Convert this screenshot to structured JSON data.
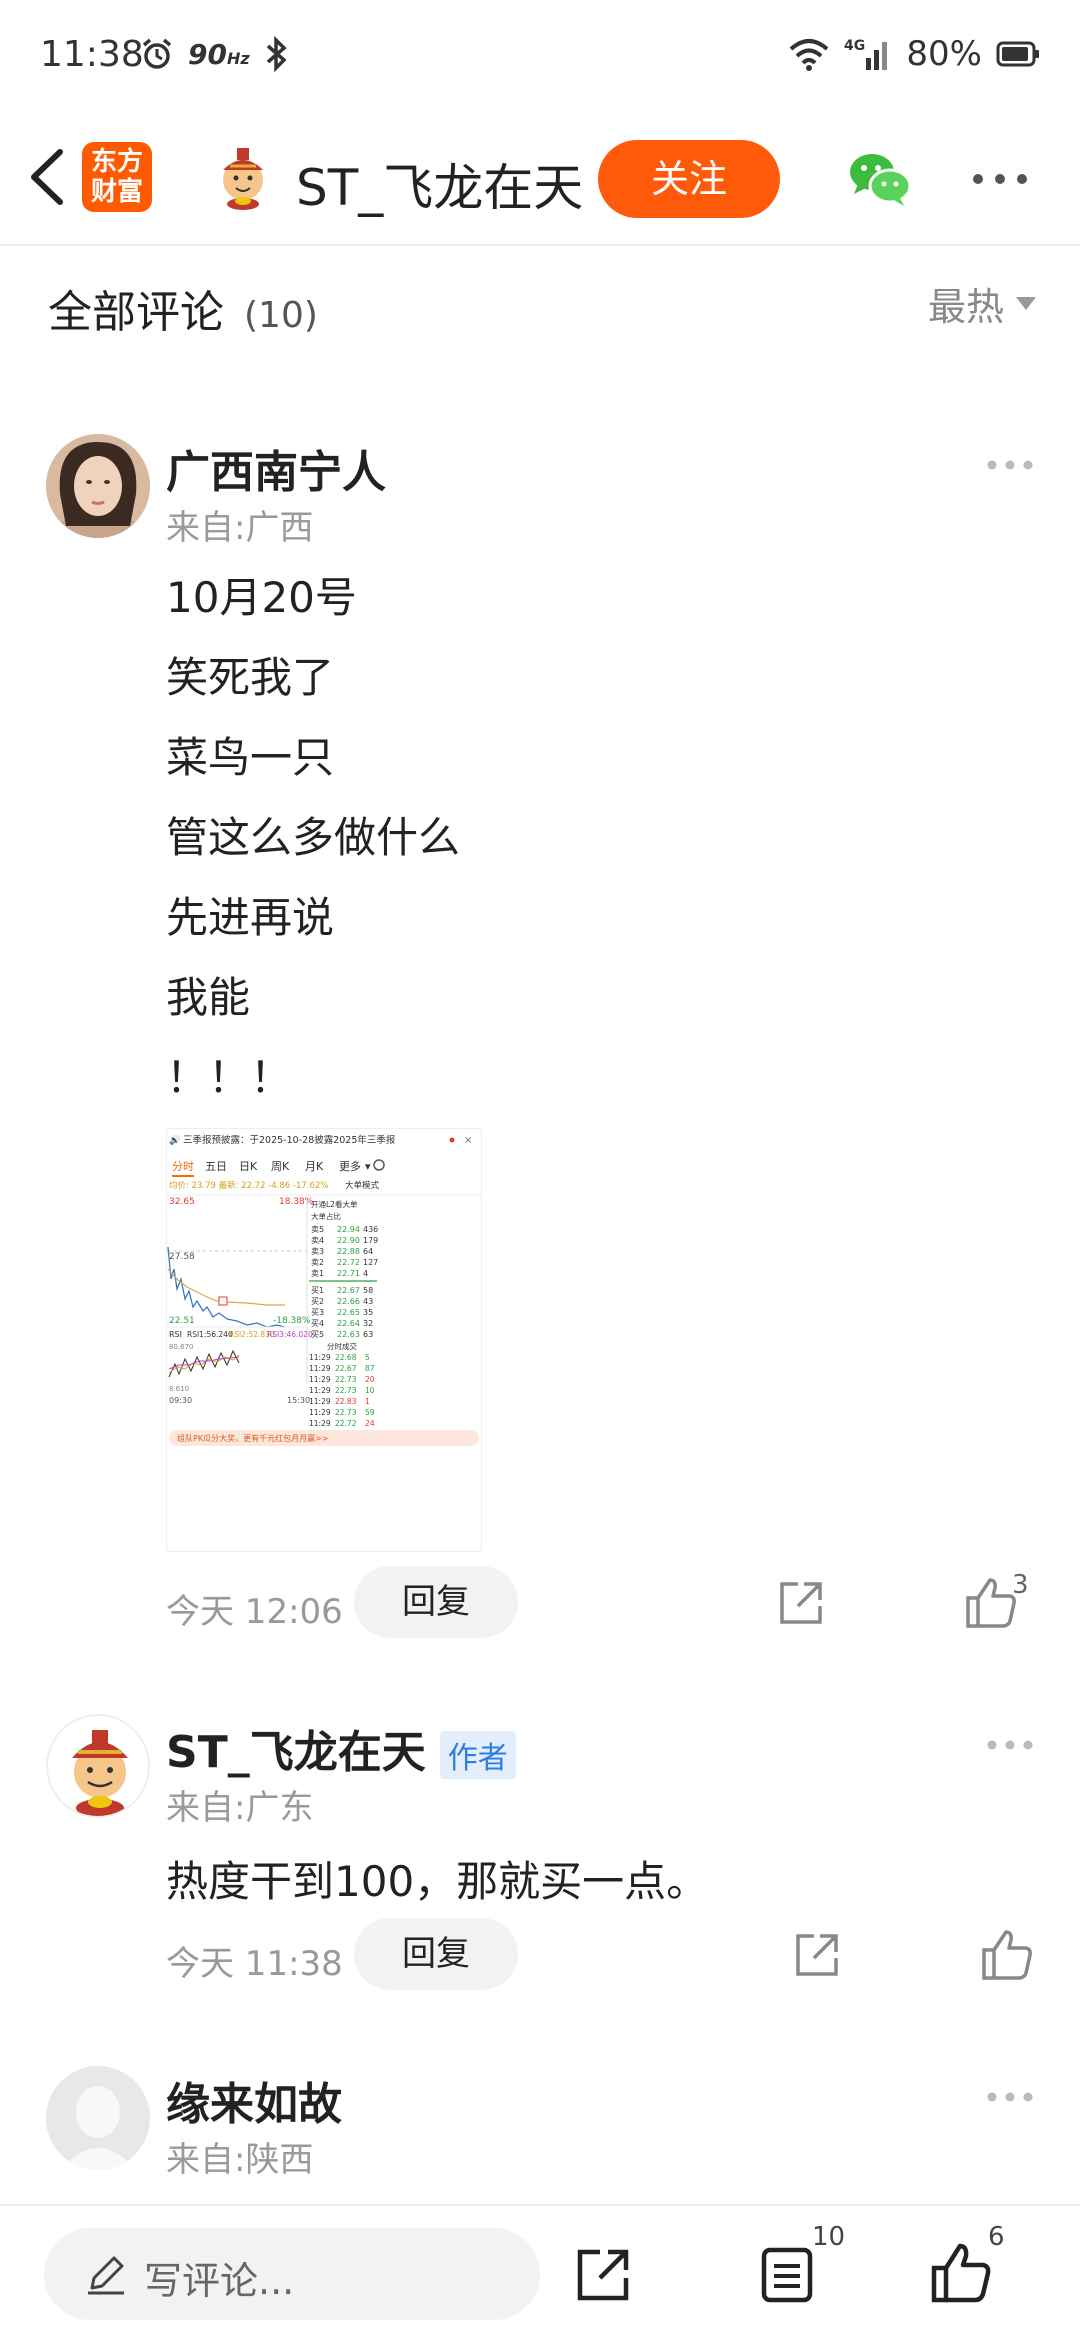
{
  "status_bar": {
    "time": "11:38",
    "refresh_rate": "90",
    "refresh_unit": "Hz",
    "network": "4G",
    "battery": "80%"
  },
  "header": {
    "app_logo_text": "东方财富",
    "title": "ST_飞龙在天",
    "follow_label": "关注",
    "brand_color": "#ff5a0a"
  },
  "comments": {
    "title": "全部评论",
    "count": "(10)",
    "sort": "最热",
    "items": [
      {
        "name": "广西南宁人",
        "from": "来自:广西",
        "lines": [
          "10月20号",
          "笑死我了",
          "菜鸟一只",
          "管这么多做什么",
          "先进再说",
          "我能",
          "！！！"
        ],
        "time": "今天 12:06",
        "reply_label": "回复",
        "likes": "3"
      },
      {
        "name": "ST_飞龙在天",
        "badge": "作者",
        "from": "来自:广东",
        "lines": [
          "热度干到100，那就买一点。"
        ],
        "time": "今天 11:38",
        "reply_label": "回复"
      },
      {
        "name": "缘来如故",
        "from": "来自:陕西"
      }
    ]
  },
  "stock_image": {
    "banner": "三季报预披露：于2025-10-28披露2025年三季报",
    "tabs": [
      "分时",
      "五日",
      "日K",
      "周K",
      "月K",
      "更多"
    ],
    "stats": "均价: 23.79 最新: 22.72 -4.86 -17.62%",
    "mode": "大单模式",
    "price_high": "32.65",
    "pct_high": "18.38%",
    "price_mid": "27.58",
    "price_low": "22.51",
    "pct_low": "-18.38%",
    "rsi_label": "RSI",
    "rsi1": "RSI1:56.240",
    "rsi2": "RSI2:52.830",
    "rsi3": "RSI3:46.020",
    "rsi_top": "80.670",
    "rsi_bottom": "8.610",
    "time_start": "09:30",
    "time_end": "15:30",
    "level2": "开通L2看大单",
    "big_order": "大单占比",
    "sells": [
      [
        "卖5",
        "22.94",
        "436"
      ],
      [
        "卖4",
        "22.90",
        "179"
      ],
      [
        "卖3",
        "22.88",
        "64"
      ],
      [
        "卖2",
        "22.72",
        "127"
      ],
      [
        "卖1",
        "22.71",
        "4"
      ]
    ],
    "buys": [
      [
        "买1",
        "22.67",
        "58"
      ],
      [
        "买2",
        "22.66",
        "43"
      ],
      [
        "买3",
        "22.65",
        "35"
      ],
      [
        "买4",
        "22.64",
        "32"
      ],
      [
        "买5",
        "22.63",
        "63"
      ]
    ],
    "ticks_title": "分时成交",
    "ticks": [
      [
        "11:29",
        "22.68",
        "5"
      ],
      [
        "11:29",
        "22.67",
        "87"
      ],
      [
        "11:29",
        "22.73",
        "20"
      ],
      [
        "11:29",
        "22.73",
        "10"
      ],
      [
        "11:29",
        "22.83",
        "1"
      ],
      [
        "11:29",
        "22.73",
        "59"
      ],
      [
        "11:29",
        "22.72",
        "24"
      ]
    ],
    "promo": "组队PK瓜分大奖，更有千元红包月月赢>>"
  },
  "bottom_bar": {
    "write_placeholder": "写评论...",
    "comment_count": "10",
    "like_count": "6"
  }
}
